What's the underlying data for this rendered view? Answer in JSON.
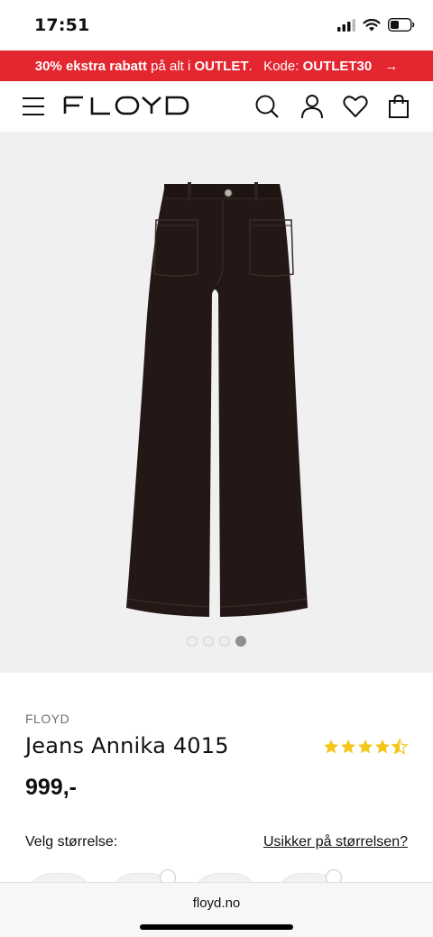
{
  "status_bar": {
    "time": "17:51"
  },
  "promo": {
    "bold_1": "30% ekstra rabatt",
    "text_1": " på alt i ",
    "bold_2": "OUTLET",
    "text_2": ".   Kode: ",
    "code": "OUTLET30",
    "arrow": "→",
    "background_color": "#e3262f"
  },
  "header": {
    "logo_text": "FLOYD",
    "icons": [
      "menu-icon",
      "search-icon",
      "user-icon",
      "heart-icon",
      "shopping-bag-icon"
    ]
  },
  "gallery": {
    "image_count": 4,
    "active_index": 3
  },
  "product": {
    "brand": "FLOYD",
    "name": "Jeans Annika 4015",
    "rating": 4.5,
    "rating_max": 5,
    "price": "999,-",
    "size_label": "Velg størrelse:",
    "size_guide_link": "Usikker på størrelsen?",
    "star_color": "#f5c518"
  },
  "browser": {
    "url": "floyd.no"
  }
}
